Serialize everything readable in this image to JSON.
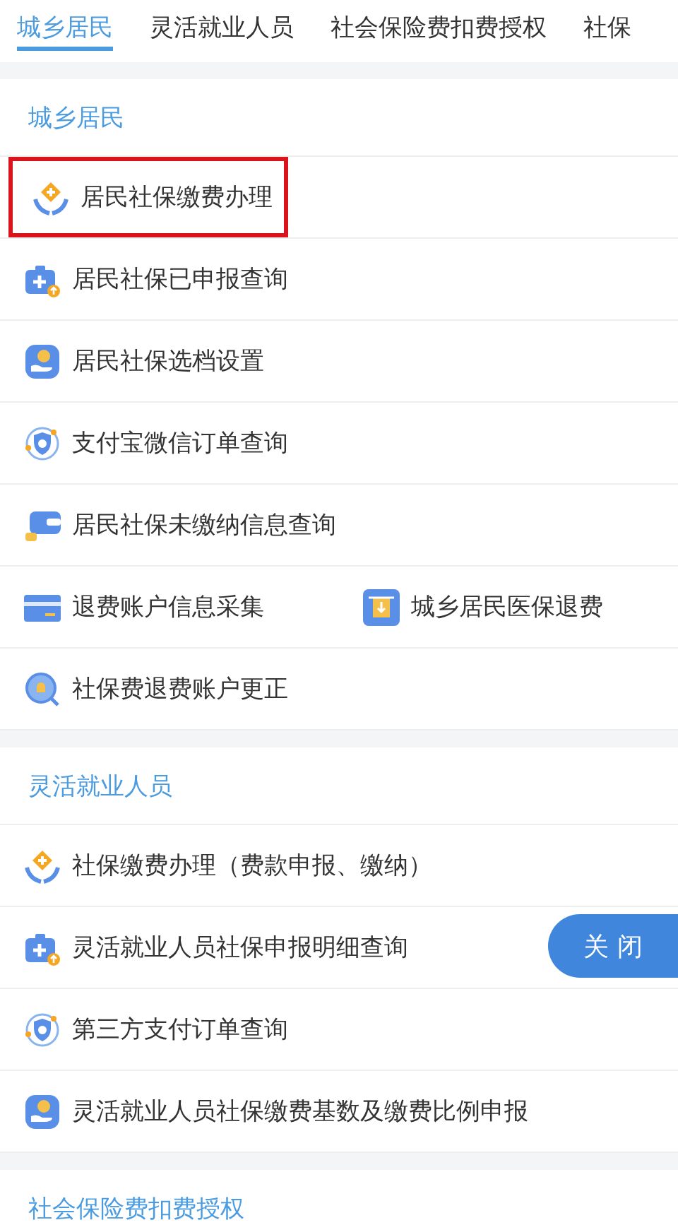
{
  "tabs": [
    {
      "label": "城乡居民",
      "selected": true
    },
    {
      "label": "灵活就业人员",
      "selected": false
    },
    {
      "label": "社会保险费扣费授权",
      "selected": false
    },
    {
      "label": "社保",
      "selected": false
    }
  ],
  "sections": [
    {
      "title": "城乡居民",
      "rows": [
        [
          {
            "label": "居民社保缴费办理",
            "kind": "hands",
            "highlighted": true
          }
        ],
        [
          {
            "label": "居民社保已申报查询",
            "kind": "medkit",
            "highlighted": false
          }
        ],
        [
          {
            "label": "居民社保选档设置",
            "kind": "coin",
            "highlighted": false
          }
        ],
        [
          {
            "label": "支付宝微信订单查询",
            "kind": "shield",
            "highlighted": false
          }
        ],
        [
          {
            "label": "居民社保未缴纳信息查询",
            "kind": "wallet",
            "highlighted": false
          }
        ],
        [
          {
            "label": "退费账户信息采集",
            "kind": "card",
            "highlighted": false
          },
          {
            "label": "城乡居民医保退费",
            "kind": "box",
            "highlighted": false
          }
        ],
        [
          {
            "label": "社保费退费账户更正",
            "kind": "search",
            "highlighted": false
          }
        ]
      ]
    },
    {
      "title": "灵活就业人员",
      "rows": [
        [
          {
            "label": "社保缴费办理（费款申报、缴纳）",
            "kind": "hands",
            "highlighted": false
          }
        ],
        [
          {
            "label": "灵活就业人员社保申报明细查询",
            "kind": "medkit",
            "highlighted": false
          }
        ],
        [
          {
            "label": "第三方支付订单查询",
            "kind": "shield",
            "highlighted": false
          }
        ],
        [
          {
            "label": "灵活就业人员社保缴费基数及缴费比例申报",
            "kind": "coin",
            "highlighted": false
          }
        ]
      ]
    },
    {
      "title": "社会保险费扣费授权"
    }
  ],
  "close_button": "关 闭"
}
